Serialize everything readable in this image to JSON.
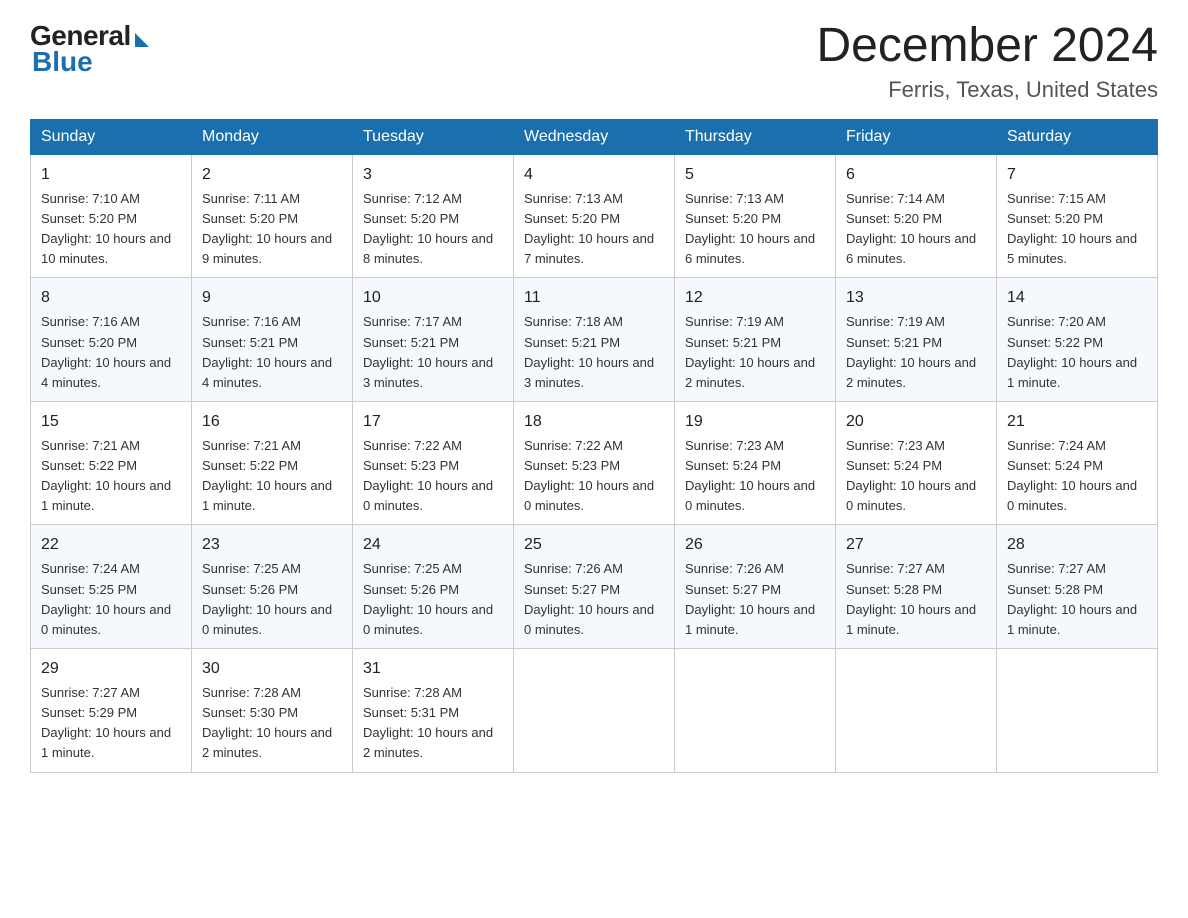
{
  "logo": {
    "general": "General",
    "blue": "Blue"
  },
  "title": {
    "month_year": "December 2024",
    "location": "Ferris, Texas, United States"
  },
  "headers": [
    "Sunday",
    "Monday",
    "Tuesday",
    "Wednesday",
    "Thursday",
    "Friday",
    "Saturday"
  ],
  "weeks": [
    [
      {
        "day": "1",
        "sunrise": "7:10 AM",
        "sunset": "5:20 PM",
        "daylight": "10 hours and 10 minutes."
      },
      {
        "day": "2",
        "sunrise": "7:11 AM",
        "sunset": "5:20 PM",
        "daylight": "10 hours and 9 minutes."
      },
      {
        "day": "3",
        "sunrise": "7:12 AM",
        "sunset": "5:20 PM",
        "daylight": "10 hours and 8 minutes."
      },
      {
        "day": "4",
        "sunrise": "7:13 AM",
        "sunset": "5:20 PM",
        "daylight": "10 hours and 7 minutes."
      },
      {
        "day": "5",
        "sunrise": "7:13 AM",
        "sunset": "5:20 PM",
        "daylight": "10 hours and 6 minutes."
      },
      {
        "day": "6",
        "sunrise": "7:14 AM",
        "sunset": "5:20 PM",
        "daylight": "10 hours and 6 minutes."
      },
      {
        "day": "7",
        "sunrise": "7:15 AM",
        "sunset": "5:20 PM",
        "daylight": "10 hours and 5 minutes."
      }
    ],
    [
      {
        "day": "8",
        "sunrise": "7:16 AM",
        "sunset": "5:20 PM",
        "daylight": "10 hours and 4 minutes."
      },
      {
        "day": "9",
        "sunrise": "7:16 AM",
        "sunset": "5:21 PM",
        "daylight": "10 hours and 4 minutes."
      },
      {
        "day": "10",
        "sunrise": "7:17 AM",
        "sunset": "5:21 PM",
        "daylight": "10 hours and 3 minutes."
      },
      {
        "day": "11",
        "sunrise": "7:18 AM",
        "sunset": "5:21 PM",
        "daylight": "10 hours and 3 minutes."
      },
      {
        "day": "12",
        "sunrise": "7:19 AM",
        "sunset": "5:21 PM",
        "daylight": "10 hours and 2 minutes."
      },
      {
        "day": "13",
        "sunrise": "7:19 AM",
        "sunset": "5:21 PM",
        "daylight": "10 hours and 2 minutes."
      },
      {
        "day": "14",
        "sunrise": "7:20 AM",
        "sunset": "5:22 PM",
        "daylight": "10 hours and 1 minute."
      }
    ],
    [
      {
        "day": "15",
        "sunrise": "7:21 AM",
        "sunset": "5:22 PM",
        "daylight": "10 hours and 1 minute."
      },
      {
        "day": "16",
        "sunrise": "7:21 AM",
        "sunset": "5:22 PM",
        "daylight": "10 hours and 1 minute."
      },
      {
        "day": "17",
        "sunrise": "7:22 AM",
        "sunset": "5:23 PM",
        "daylight": "10 hours and 0 minutes."
      },
      {
        "day": "18",
        "sunrise": "7:22 AM",
        "sunset": "5:23 PM",
        "daylight": "10 hours and 0 minutes."
      },
      {
        "day": "19",
        "sunrise": "7:23 AM",
        "sunset": "5:24 PM",
        "daylight": "10 hours and 0 minutes."
      },
      {
        "day": "20",
        "sunrise": "7:23 AM",
        "sunset": "5:24 PM",
        "daylight": "10 hours and 0 minutes."
      },
      {
        "day": "21",
        "sunrise": "7:24 AM",
        "sunset": "5:24 PM",
        "daylight": "10 hours and 0 minutes."
      }
    ],
    [
      {
        "day": "22",
        "sunrise": "7:24 AM",
        "sunset": "5:25 PM",
        "daylight": "10 hours and 0 minutes."
      },
      {
        "day": "23",
        "sunrise": "7:25 AM",
        "sunset": "5:26 PM",
        "daylight": "10 hours and 0 minutes."
      },
      {
        "day": "24",
        "sunrise": "7:25 AM",
        "sunset": "5:26 PM",
        "daylight": "10 hours and 0 minutes."
      },
      {
        "day": "25",
        "sunrise": "7:26 AM",
        "sunset": "5:27 PM",
        "daylight": "10 hours and 0 minutes."
      },
      {
        "day": "26",
        "sunrise": "7:26 AM",
        "sunset": "5:27 PM",
        "daylight": "10 hours and 1 minute."
      },
      {
        "day": "27",
        "sunrise": "7:27 AM",
        "sunset": "5:28 PM",
        "daylight": "10 hours and 1 minute."
      },
      {
        "day": "28",
        "sunrise": "7:27 AM",
        "sunset": "5:28 PM",
        "daylight": "10 hours and 1 minute."
      }
    ],
    [
      {
        "day": "29",
        "sunrise": "7:27 AM",
        "sunset": "5:29 PM",
        "daylight": "10 hours and 1 minute."
      },
      {
        "day": "30",
        "sunrise": "7:28 AM",
        "sunset": "5:30 PM",
        "daylight": "10 hours and 2 minutes."
      },
      {
        "day": "31",
        "sunrise": "7:28 AM",
        "sunset": "5:31 PM",
        "daylight": "10 hours and 2 minutes."
      },
      null,
      null,
      null,
      null
    ]
  ]
}
